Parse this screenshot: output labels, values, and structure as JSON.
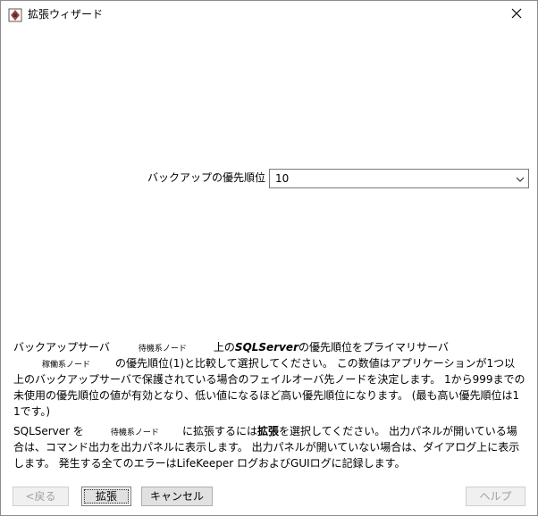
{
  "window": {
    "title": "拡張ウィザード",
    "icon": "app-icon",
    "close_icon": "close-icon"
  },
  "priority": {
    "label": "バックアップの優先順位",
    "selected_value": "10",
    "dropdown_icon": "chevron-down-icon"
  },
  "description": {
    "p1_line1": {
      "a": "バックアップサーバ",
      "standby_node": "待機系ノード",
      "b": "上の",
      "product": "SQLServer",
      "c": "の優先順位をプライマリサーバ"
    },
    "p1_line2": {
      "active_node": "稼働系ノード",
      "a": "の優先順位(1)と比較して選択してください。 この数値はアプリケーションが1つ以"
    },
    "p1_line3": "上のバックアップサーバで保護されている場合のフェイルオーバ先ノードを決定します。 1から999までの",
    "p1_line4": "未使用の優先順位の値が有効となり、低い値になるほど高い優先順位になります。 (最も高い優先順位は1",
    "p1_line5": "1です。)",
    "p2_line1": {
      "a": "SQLServer を",
      "standby_node": "待機系ノード",
      "b": "に拡張するには",
      "bold": "拡張",
      "c": "を選択してください。 出力パネルが開いている場"
    },
    "p2_line2": "合は、コマンド出力を出力パネルに表示します。 出力パネルが開いていない場合は、ダイアログ上に表示",
    "p2_line3": "します。 発生する全てのエラーはLifeKeeper ログおよびGUIログに記録します。"
  },
  "buttons": {
    "back": "<戻る",
    "extend": "拡張",
    "cancel": "キャンセル",
    "help": "ヘルプ"
  },
  "colors": {
    "disabled_text": "#a0a0a0",
    "button_bg": "#e1e1e1",
    "border": "#7a7a7a"
  }
}
